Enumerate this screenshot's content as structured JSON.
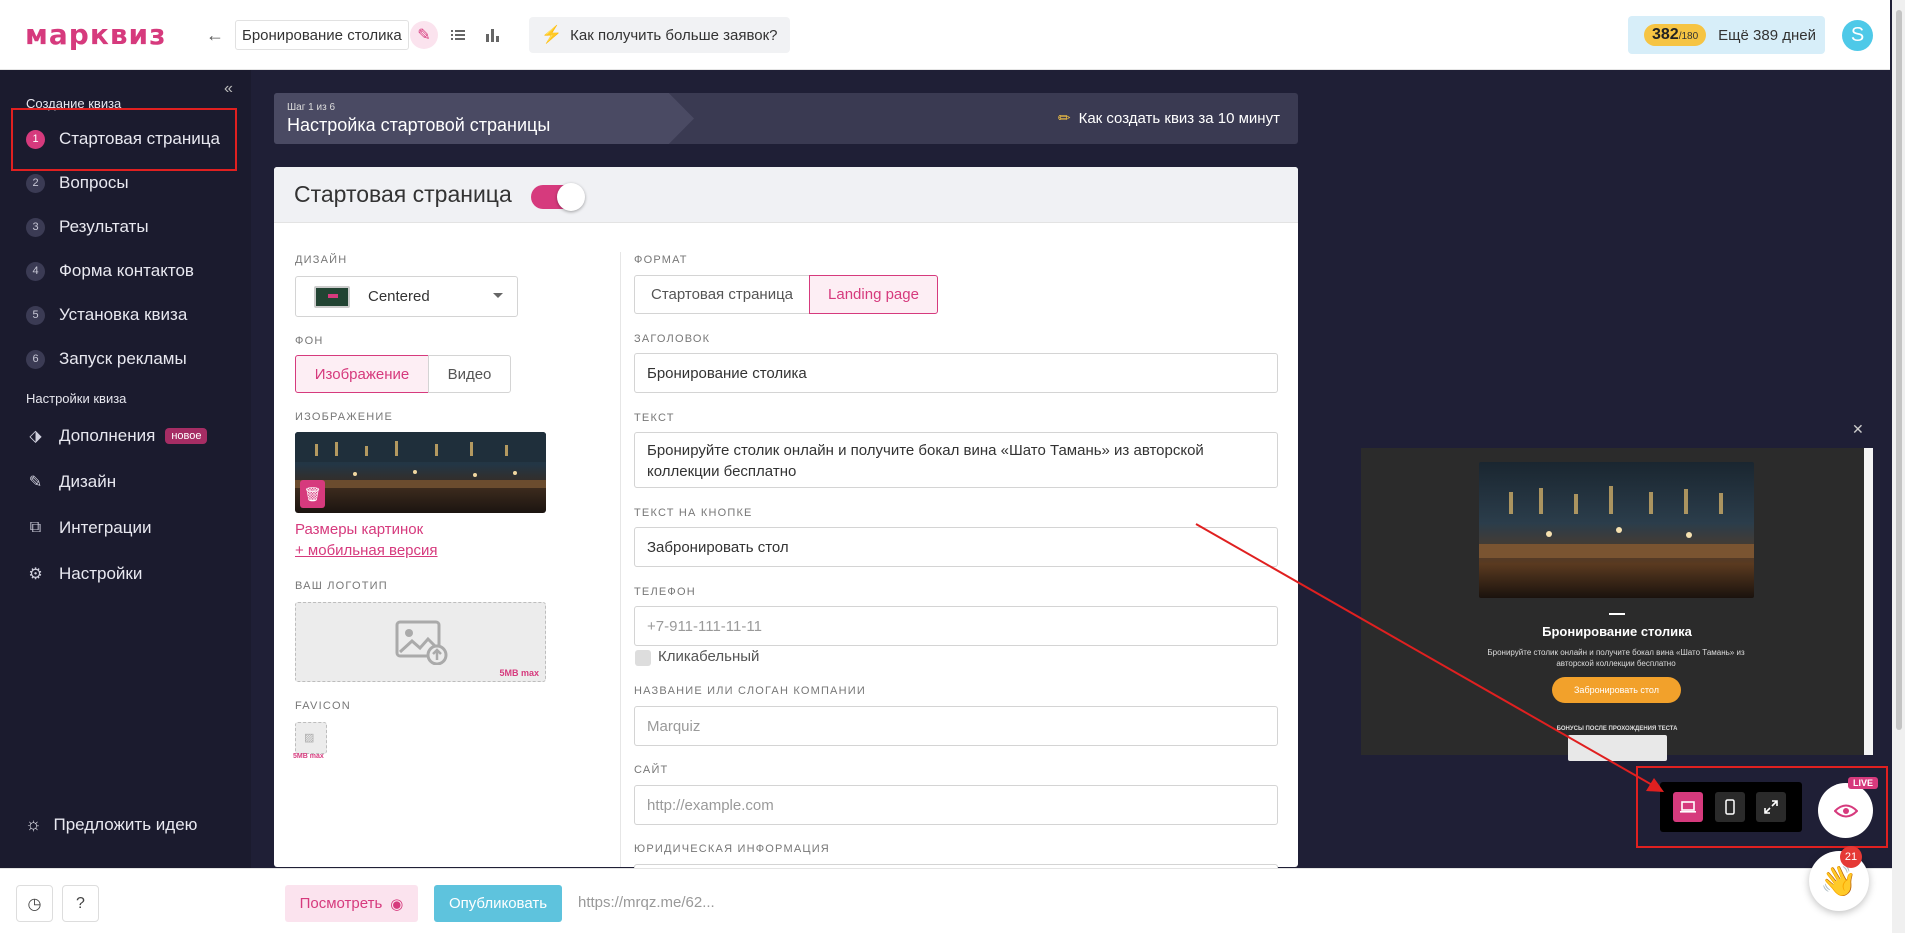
{
  "header": {
    "logo": "марквиз",
    "quiz_title": "Бронирование столика",
    "tips_label": "Как получить больше заявок?",
    "balance_main": "382",
    "balance_sub": "/180",
    "days_left": "Ещё 389 дней",
    "avatar_letter": "S"
  },
  "sidebar": {
    "section_create": "Создание квиза",
    "steps": [
      {
        "num": "1",
        "label": "Стартовая страница"
      },
      {
        "num": "2",
        "label": "Вопросы"
      },
      {
        "num": "3",
        "label": "Результаты"
      },
      {
        "num": "4",
        "label": "Форма контактов"
      },
      {
        "num": "5",
        "label": "Установка квиза"
      },
      {
        "num": "6",
        "label": "Запуск рекламы"
      }
    ],
    "section_settings": "Настройки квиза",
    "settings": [
      {
        "label": "Дополнения",
        "badge": "новое"
      },
      {
        "label": "Дизайн"
      },
      {
        "label": "Интеграции"
      },
      {
        "label": "Настройки"
      }
    ],
    "suggest": "Предложить идею"
  },
  "step": {
    "counter": "Шаг 1 из 6",
    "title": "Настройка стартовой страницы",
    "howto": "Как создать квиз за 10 минут"
  },
  "card": {
    "title": "Стартовая страница",
    "design_label": "ДИЗАЙН",
    "design_value": "Centered",
    "bg_label": "ФОН",
    "bg_image": "Изображение",
    "bg_video": "Видео",
    "image_label": "ИЗОБРАЖЕНИЕ",
    "image_sizes": "Размеры картинок",
    "mobile_version": "+ мобильная версия",
    "logo_label": "ВАШ ЛОГОТИП",
    "logo_max": "5MB max",
    "favicon_label": "FAVICON",
    "favicon_max": "5MB max",
    "format_label": "ФОРМАТ",
    "format_start": "Стартовая страница",
    "format_landing": "Landing page",
    "heading_label": "ЗАГОЛОВОК",
    "heading_value": "Бронирование столика",
    "text_label": "ТЕКСТ",
    "text_value": "Бронируйте столик онлайн и получите бокал вина «Шато Тамань» из авторской коллекции бесплатно",
    "button_text_label": "ТЕКСТ НА КНОПКЕ",
    "button_text_value": "Забронировать стол",
    "phone_label": "ТЕЛЕФОН",
    "phone_placeholder": "+7-911-111-11-11",
    "clickable_label": "Кликабельный",
    "company_label": "НАЗВАНИЕ ИЛИ СЛОГАН КОМПАНИИ",
    "company_placeholder": "Marquiz",
    "site_label": "САЙТ",
    "site_placeholder": "http://example.com",
    "legal_label": "ЮРИДИЧЕСКАЯ ИНФОРМАЦИЯ"
  },
  "bottom": {
    "view_label": "Посмотреть",
    "publish_label": "Опубликовать",
    "url": "https://mrqz.me/62..."
  },
  "preview": {
    "title": "Бронирование столика",
    "text": "Бронируйте столик онлайн и получите бокал вина «Шато Тамань» из авторской коллекции бесплатно",
    "button": "Забронировать стол",
    "bonus": "БОНУСЫ ПОСЛЕ ПРОХОЖДЕНИЯ ТЕСТА",
    "live": "LIVE",
    "notifications": "21"
  },
  "colors": {
    "accent": "#d63a7d",
    "sidebar": "#1b1b2e",
    "publish": "#5ec3dd",
    "annotation": "#e02020"
  }
}
